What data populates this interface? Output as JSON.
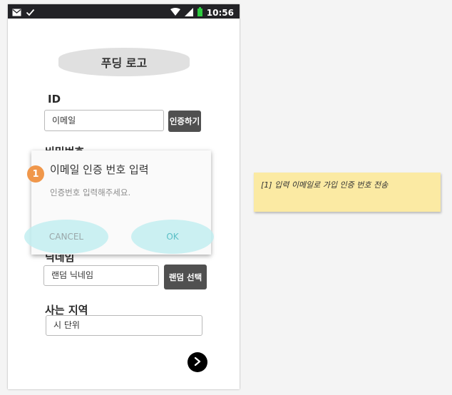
{
  "status_bar": {
    "time": "10:56",
    "icons": [
      "mail-icon",
      "check-icon",
      "wifi-icon",
      "signal-icon",
      "battery-icon"
    ],
    "battery_color": "#2ecc40"
  },
  "logo": {
    "text": "푸딩 로고"
  },
  "id_section": {
    "label": "ID",
    "input_value": "이메일",
    "verify_button": "인증하기"
  },
  "password_section": {
    "label_partial": "비밀번호"
  },
  "nickname_section": {
    "label_partial": "닉네임",
    "input_value": "랜덤 닉네임",
    "random_button": "랜덤 선택"
  },
  "region_section": {
    "label": "사는 지역",
    "input_value": "시 단위"
  },
  "next_button": {
    "icon": "chevron-right-icon"
  },
  "dialog": {
    "title": "이메일 인증 번호 입력",
    "message": "인증번호 입력해주세요.",
    "cancel_label": "CANCEL",
    "ok_label": "OK",
    "highlight_color": "#bfeef0",
    "button_color": "#5bbfc6"
  },
  "badge": {
    "number": "1",
    "color": "#f0974b"
  },
  "note": {
    "text": "[1]  입력 이메일로 가입 인증 번호 전송",
    "color": "#fbeaa3"
  }
}
